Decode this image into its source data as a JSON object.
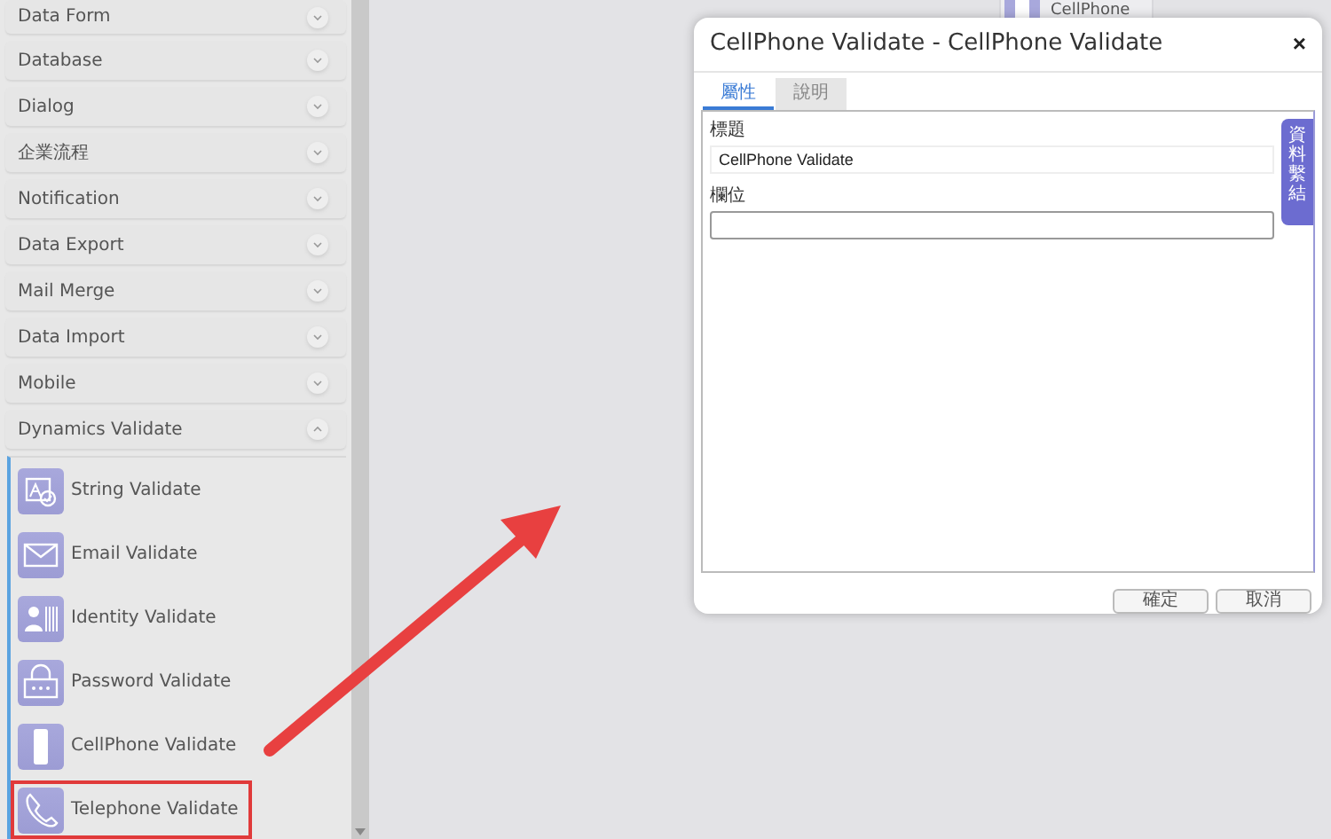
{
  "sidebar": {
    "categories": [
      {
        "label": "Data Form",
        "expanded": false
      },
      {
        "label": "Database",
        "expanded": false
      },
      {
        "label": "Dialog",
        "expanded": false
      },
      {
        "label": "企業流程",
        "expanded": false
      },
      {
        "label": "Notification",
        "expanded": false
      },
      {
        "label": "Data Export",
        "expanded": false
      },
      {
        "label": "Mail Merge",
        "expanded": false
      },
      {
        "label": "Data Import",
        "expanded": false
      },
      {
        "label": "Mobile",
        "expanded": false
      },
      {
        "label": "Dynamics Validate",
        "expanded": true,
        "items": [
          {
            "label": "String Validate",
            "kind": "string",
            "highlighted": false
          },
          {
            "label": "Email Validate",
            "kind": "email",
            "highlighted": false
          },
          {
            "label": "Identity Validate",
            "kind": "identity",
            "highlighted": false
          },
          {
            "label": "Password Validate",
            "kind": "password",
            "highlighted": false
          },
          {
            "label": "CellPhone Validate",
            "kind": "cellphone",
            "highlighted": false
          },
          {
            "label": "Telephone Validate",
            "kind": "telephone",
            "highlighted": true
          }
        ]
      }
    ]
  },
  "canvas": {
    "node": {
      "label": "CellPhone"
    }
  },
  "dialog": {
    "title": "CellPhone Validate - CellPhone Validate",
    "close": "×",
    "tabs": [
      {
        "label": "屬性",
        "selected": true
      },
      {
        "label": "說明",
        "selected": false
      }
    ],
    "fields": [
      {
        "label": "標題",
        "value": "CellPhone Validate",
        "focused": false
      },
      {
        "label": "欄位",
        "focused": true
      }
    ],
    "side_tab": "資料繫結",
    "buttons": [
      "確定",
      "取消"
    ]
  }
}
